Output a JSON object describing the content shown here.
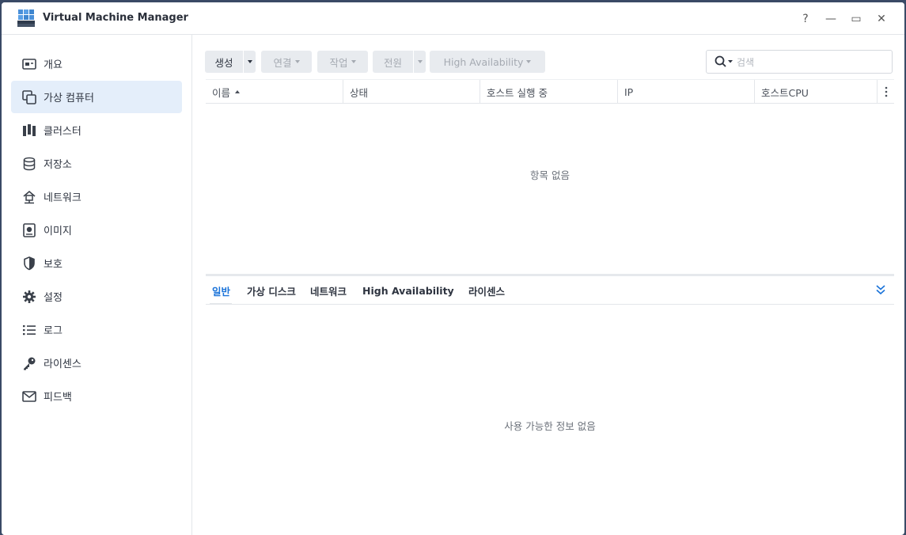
{
  "window": {
    "title": "Virtual Machine Manager",
    "controls": [
      "?",
      "—",
      "▭",
      "✕"
    ]
  },
  "sidebar": {
    "items": [
      {
        "label": "개요",
        "icon": "overview-icon"
      },
      {
        "label": "가상 컴퓨터",
        "icon": "virtual-machine-icon",
        "active": true
      },
      {
        "label": "클러스터",
        "icon": "cluster-icon"
      },
      {
        "label": "저장소",
        "icon": "storage-icon"
      },
      {
        "label": "네트워크",
        "icon": "network-icon"
      },
      {
        "label": "이미지",
        "icon": "image-icon"
      },
      {
        "label": "보호",
        "icon": "shield-icon"
      },
      {
        "label": "설정",
        "icon": "gear-icon"
      },
      {
        "label": "로그",
        "icon": "log-list-icon"
      },
      {
        "label": "라이센스",
        "icon": "key-icon"
      },
      {
        "label": "피드백",
        "icon": "mail-icon"
      }
    ]
  },
  "toolbar": {
    "create": "생성",
    "connect": "연결",
    "action": "작업",
    "power": "전원",
    "high_availability": "High Availability"
  },
  "search": {
    "placeholder": "검색"
  },
  "grid": {
    "columns": [
      "이름",
      "상태",
      "호스트 실행 중",
      "IP",
      "호스트CPU"
    ],
    "empty": "항목 없음"
  },
  "detail": {
    "tabs": [
      "일반",
      "가상 디스크",
      "네트워크",
      "High Availability",
      "라이센스"
    ],
    "active_tab": "일반",
    "empty": "사용 가능한 정보 없음"
  },
  "colors": {
    "accent": "#1a73d9",
    "active_nav_bg": "#e4eefa",
    "button_bg": "#e8ebef"
  }
}
